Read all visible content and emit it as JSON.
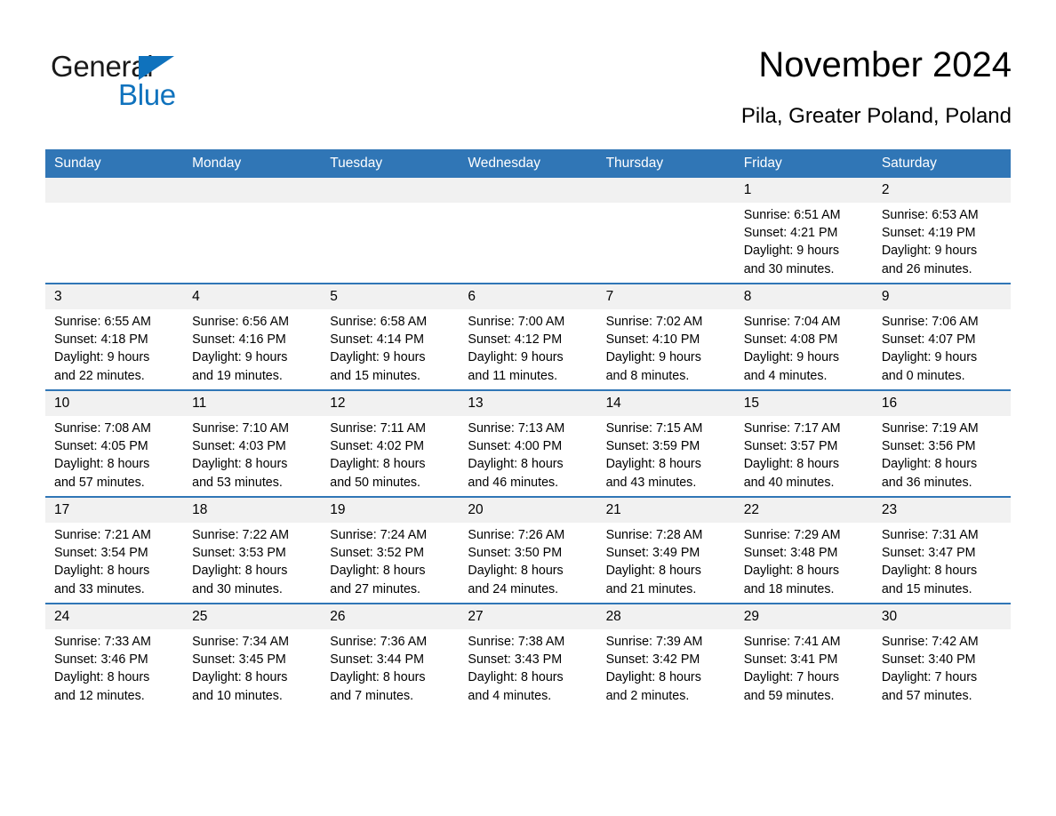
{
  "brand": {
    "name_part1": "General",
    "name_part2": "Blue",
    "triangle_color": "#0f72bd"
  },
  "header": {
    "title": "November 2024",
    "location": "Pila, Greater Poland, Poland"
  },
  "theme": {
    "header_blue": "#3076b6",
    "daynum_band": "#f1f1f1",
    "text": "#000000"
  },
  "calendar": {
    "weekday_headers": [
      "Sunday",
      "Monday",
      "Tuesday",
      "Wednesday",
      "Thursday",
      "Friday",
      "Saturday"
    ],
    "weeks": [
      [
        {
          "day": "",
          "lines": []
        },
        {
          "day": "",
          "lines": []
        },
        {
          "day": "",
          "lines": []
        },
        {
          "day": "",
          "lines": []
        },
        {
          "day": "",
          "lines": []
        },
        {
          "day": "1",
          "lines": [
            "Sunrise: 6:51 AM",
            "Sunset: 4:21 PM",
            "Daylight: 9 hours",
            "and 30 minutes."
          ]
        },
        {
          "day": "2",
          "lines": [
            "Sunrise: 6:53 AM",
            "Sunset: 4:19 PM",
            "Daylight: 9 hours",
            "and 26 minutes."
          ]
        }
      ],
      [
        {
          "day": "3",
          "lines": [
            "Sunrise: 6:55 AM",
            "Sunset: 4:18 PM",
            "Daylight: 9 hours",
            "and 22 minutes."
          ]
        },
        {
          "day": "4",
          "lines": [
            "Sunrise: 6:56 AM",
            "Sunset: 4:16 PM",
            "Daylight: 9 hours",
            "and 19 minutes."
          ]
        },
        {
          "day": "5",
          "lines": [
            "Sunrise: 6:58 AM",
            "Sunset: 4:14 PM",
            "Daylight: 9 hours",
            "and 15 minutes."
          ]
        },
        {
          "day": "6",
          "lines": [
            "Sunrise: 7:00 AM",
            "Sunset: 4:12 PM",
            "Daylight: 9 hours",
            "and 11 minutes."
          ]
        },
        {
          "day": "7",
          "lines": [
            "Sunrise: 7:02 AM",
            "Sunset: 4:10 PM",
            "Daylight: 9 hours",
            "and 8 minutes."
          ]
        },
        {
          "day": "8",
          "lines": [
            "Sunrise: 7:04 AM",
            "Sunset: 4:08 PM",
            "Daylight: 9 hours",
            "and 4 minutes."
          ]
        },
        {
          "day": "9",
          "lines": [
            "Sunrise: 7:06 AM",
            "Sunset: 4:07 PM",
            "Daylight: 9 hours",
            "and 0 minutes."
          ]
        }
      ],
      [
        {
          "day": "10",
          "lines": [
            "Sunrise: 7:08 AM",
            "Sunset: 4:05 PM",
            "Daylight: 8 hours",
            "and 57 minutes."
          ]
        },
        {
          "day": "11",
          "lines": [
            "Sunrise: 7:10 AM",
            "Sunset: 4:03 PM",
            "Daylight: 8 hours",
            "and 53 minutes."
          ]
        },
        {
          "day": "12",
          "lines": [
            "Sunrise: 7:11 AM",
            "Sunset: 4:02 PM",
            "Daylight: 8 hours",
            "and 50 minutes."
          ]
        },
        {
          "day": "13",
          "lines": [
            "Sunrise: 7:13 AM",
            "Sunset: 4:00 PM",
            "Daylight: 8 hours",
            "and 46 minutes."
          ]
        },
        {
          "day": "14",
          "lines": [
            "Sunrise: 7:15 AM",
            "Sunset: 3:59 PM",
            "Daylight: 8 hours",
            "and 43 minutes."
          ]
        },
        {
          "day": "15",
          "lines": [
            "Sunrise: 7:17 AM",
            "Sunset: 3:57 PM",
            "Daylight: 8 hours",
            "and 40 minutes."
          ]
        },
        {
          "day": "16",
          "lines": [
            "Sunrise: 7:19 AM",
            "Sunset: 3:56 PM",
            "Daylight: 8 hours",
            "and 36 minutes."
          ]
        }
      ],
      [
        {
          "day": "17",
          "lines": [
            "Sunrise: 7:21 AM",
            "Sunset: 3:54 PM",
            "Daylight: 8 hours",
            "and 33 minutes."
          ]
        },
        {
          "day": "18",
          "lines": [
            "Sunrise: 7:22 AM",
            "Sunset: 3:53 PM",
            "Daylight: 8 hours",
            "and 30 minutes."
          ]
        },
        {
          "day": "19",
          "lines": [
            "Sunrise: 7:24 AM",
            "Sunset: 3:52 PM",
            "Daylight: 8 hours",
            "and 27 minutes."
          ]
        },
        {
          "day": "20",
          "lines": [
            "Sunrise: 7:26 AM",
            "Sunset: 3:50 PM",
            "Daylight: 8 hours",
            "and 24 minutes."
          ]
        },
        {
          "day": "21",
          "lines": [
            "Sunrise: 7:28 AM",
            "Sunset: 3:49 PM",
            "Daylight: 8 hours",
            "and 21 minutes."
          ]
        },
        {
          "day": "22",
          "lines": [
            "Sunrise: 7:29 AM",
            "Sunset: 3:48 PM",
            "Daylight: 8 hours",
            "and 18 minutes."
          ]
        },
        {
          "day": "23",
          "lines": [
            "Sunrise: 7:31 AM",
            "Sunset: 3:47 PM",
            "Daylight: 8 hours",
            "and 15 minutes."
          ]
        }
      ],
      [
        {
          "day": "24",
          "lines": [
            "Sunrise: 7:33 AM",
            "Sunset: 3:46 PM",
            "Daylight: 8 hours",
            "and 12 minutes."
          ]
        },
        {
          "day": "25",
          "lines": [
            "Sunrise: 7:34 AM",
            "Sunset: 3:45 PM",
            "Daylight: 8 hours",
            "and 10 minutes."
          ]
        },
        {
          "day": "26",
          "lines": [
            "Sunrise: 7:36 AM",
            "Sunset: 3:44 PM",
            "Daylight: 8 hours",
            "and 7 minutes."
          ]
        },
        {
          "day": "27",
          "lines": [
            "Sunrise: 7:38 AM",
            "Sunset: 3:43 PM",
            "Daylight: 8 hours",
            "and 4 minutes."
          ]
        },
        {
          "day": "28",
          "lines": [
            "Sunrise: 7:39 AM",
            "Sunset: 3:42 PM",
            "Daylight: 8 hours",
            "and 2 minutes."
          ]
        },
        {
          "day": "29",
          "lines": [
            "Sunrise: 7:41 AM",
            "Sunset: 3:41 PM",
            "Daylight: 7 hours",
            "and 59 minutes."
          ]
        },
        {
          "day": "30",
          "lines": [
            "Sunrise: 7:42 AM",
            "Sunset: 3:40 PM",
            "Daylight: 7 hours",
            "and 57 minutes."
          ]
        }
      ]
    ]
  }
}
